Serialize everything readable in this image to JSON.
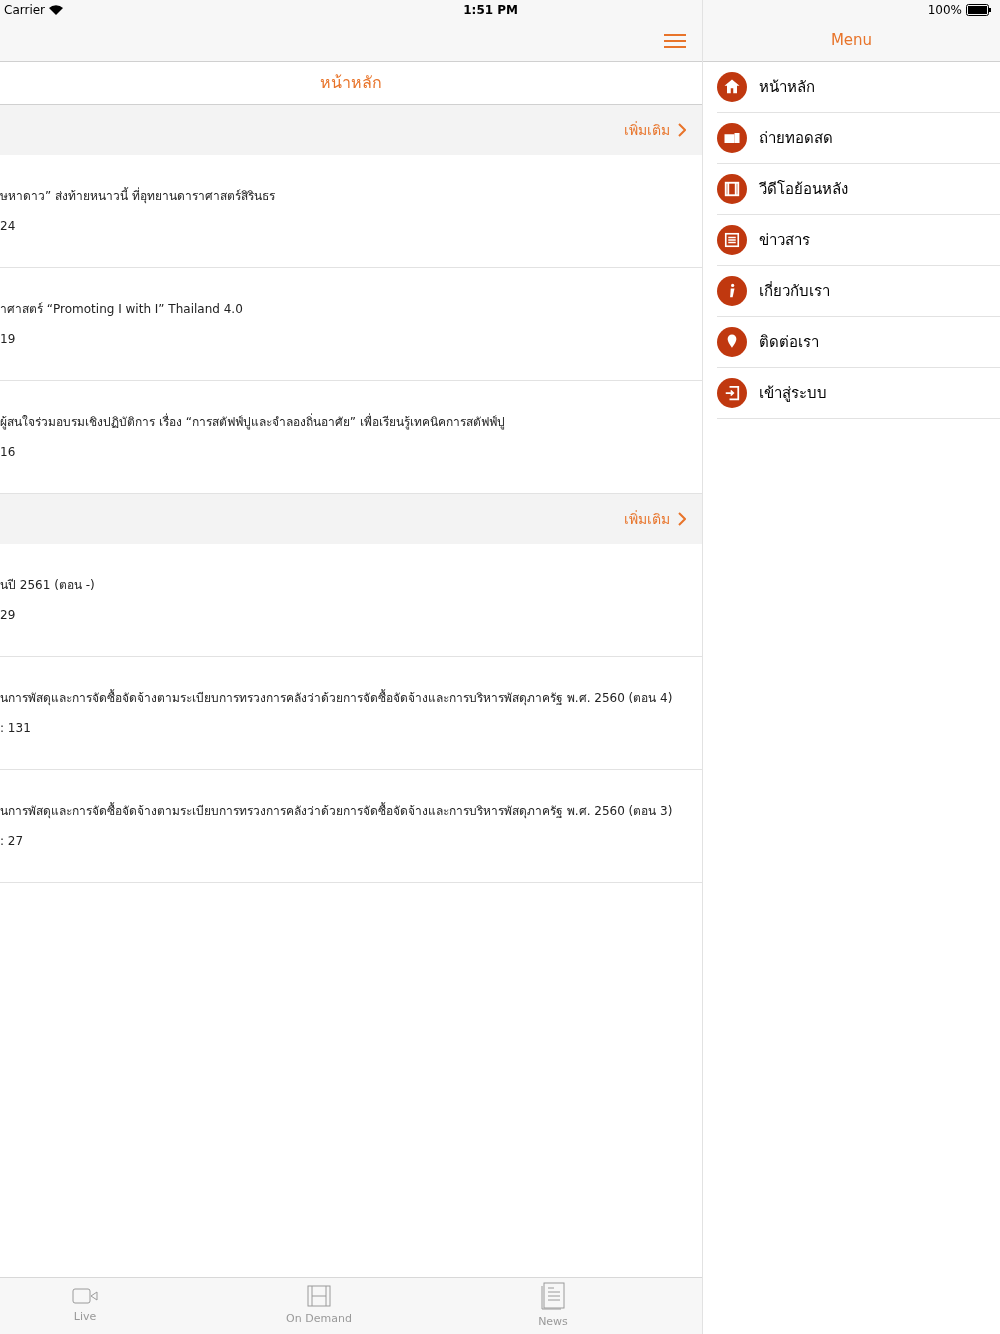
{
  "status_bar": {
    "carrier": "Carrier",
    "time": "1:51 PM",
    "battery": "100%"
  },
  "page_title": "หน้าหลัก",
  "sections": [
    {
      "more": "เพิ่มเติม",
      "rows": [
        {
          "title": "ษหาดาว” ส่งท้ายหนาวนี้ ที่อุทยานดาราศาสตร์สิรินธร",
          "count": "24"
        },
        {
          "title": "าศาสตร์ “Promoting I with I” Thailand 4.0",
          "count": "19"
        },
        {
          "title": "ผู้สนใจร่วมอบรมเชิงปฏิบัติการ เรื่อง “การสตัฟฟ์ปูและจำลองถิ่นอาศัย” เพื่อเรียนรู้เทคนิคการสตัฟฟ์ปู",
          "count": "16"
        }
      ]
    },
    {
      "more": "เพิ่มเติม",
      "rows": [
        {
          "title": "นปี 2561 (ตอน -)",
          "count": "29"
        },
        {
          "title": "นการพัสดุและการจัดซื้อจัดจ้างตามระเบียบการทรวงการคลังว่าด้วยการจัดซื้อจัดจ้างและการบริหารพัสดุภาครัฐ พ.ศ. 2560 (ตอน 4)",
          "count": ": 131"
        },
        {
          "title": "นการพัสดุและการจัดซื้อจัดจ้างตามระเบียบการทรวงการคลังว่าด้วยการจัดซื้อจัดจ้างและการบริหารพัสดุภาครัฐ พ.ศ. 2560 (ตอน 3)",
          "count": ": 27"
        }
      ]
    }
  ],
  "tab_bar": [
    {
      "kind": "live",
      "label": "Live"
    },
    {
      "kind": "demand",
      "label": "On Demand"
    },
    {
      "kind": "news",
      "label": "News"
    }
  ],
  "menu": {
    "title": "Menu",
    "items": [
      {
        "kind": "home",
        "label": "หน้าหลัก"
      },
      {
        "kind": "live",
        "label": "ถ่ายทอดสด"
      },
      {
        "kind": "video",
        "label": "วีดีโอย้อนหลัง"
      },
      {
        "kind": "news",
        "label": "ข่าวสาร"
      },
      {
        "kind": "info",
        "label": "เกี่ยวกับเรา"
      },
      {
        "kind": "pin",
        "label": "ติดต่อเรา"
      },
      {
        "kind": "login",
        "label": "เข้าสู่ระบบ"
      }
    ]
  }
}
